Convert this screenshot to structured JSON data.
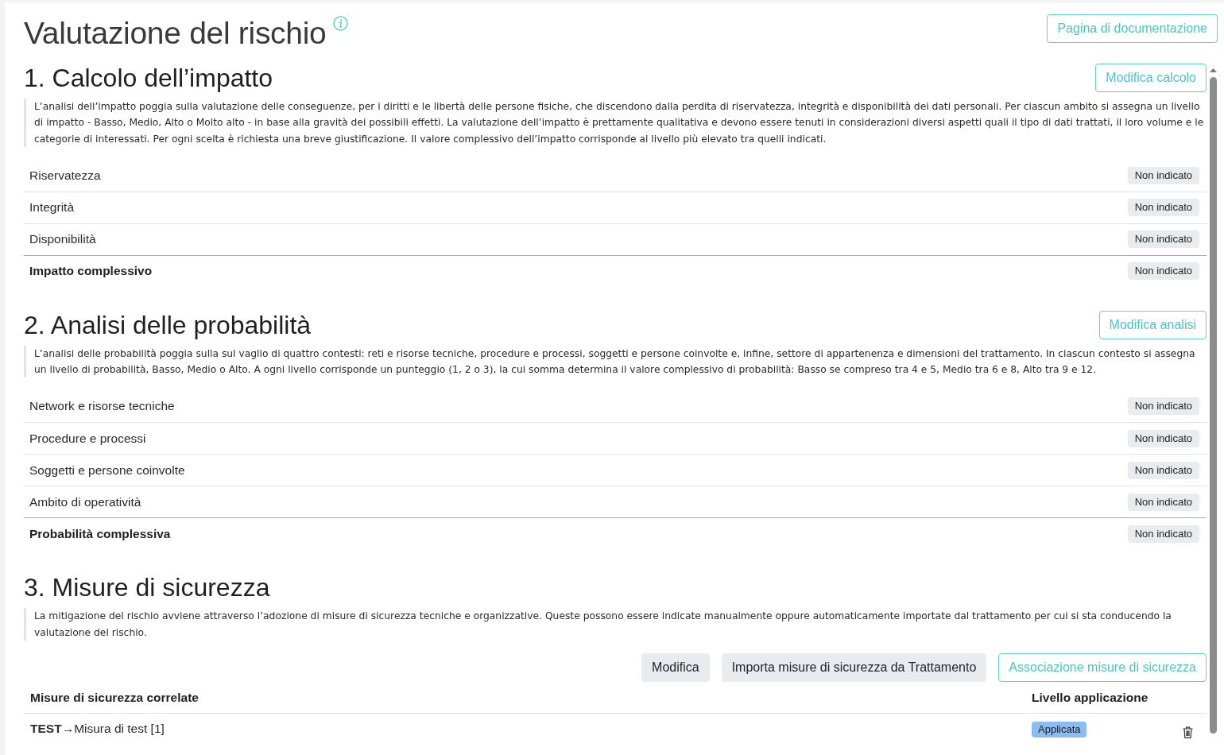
{
  "page": {
    "title": "Valutazione del rischio",
    "documentation_button": "Pagina di documentazione"
  },
  "sections": [
    {
      "kind": "rated",
      "heading": "1. Calcolo dell’impatto",
      "button": "Modifica calcolo",
      "description": "L’analisi dell’impatto poggia sulla valutazione delle conseguenze, per i diritti e le libertà delle persone fisiche, che discendono dalla perdita di riservatezza, integrità e disponibilità dei dati personali. Per ciascun ambito si assegna un livello di impatto - Basso, Medio, Alto o Molto alto - in base alla gravità dei possibili effetti. La valutazione dell’impatto è prettamente qualitativa e devono essere tenuti in considerazioni diversi aspetti quali il tipo di dati trattati, il loro volume e le categorie di interessati. Per ogni scelta è richiesta una breve giustificazione. Il valore complessivo dell’impatto corrisponde al livello più elevato tra quelli indicati.",
      "rows": [
        {
          "kind": "item",
          "label": "Riservatezza",
          "value": "Non indicato"
        },
        {
          "kind": "item",
          "label": "Integrità",
          "value": "Non indicato"
        },
        {
          "kind": "item",
          "label": "Disponibilità",
          "value": "Non indicato"
        },
        {
          "kind": "total",
          "label": "Impatto complessivo",
          "value": "Non indicato"
        }
      ]
    },
    {
      "kind": "rated",
      "heading": "2. Analisi delle probabilità",
      "button": "Modifica analisi",
      "description": "L’analisi delle probabilità poggia sulla sul vaglio di quattro contesti: reti e risorse tecniche, procedure e processi, soggetti e persone coinvolte e, infine, settore di appartenenza e dimensioni del trattamento. In ciascun contesto si assegna un livello di probabilità, Basso, Medio o Alto. A ogni livello corrisponde un punteggio (1, 2 o 3), la cui somma determina il valore complessivo di probabilità: Basso se compreso tra 4 e 5, Medio tra 6 e 8, Alto tra 9 e 12.",
      "rows": [
        {
          "kind": "item",
          "label": "Network e risorse tecniche",
          "value": "Non indicato"
        },
        {
          "kind": "item",
          "label": "Procedure e processi",
          "value": "Non indicato"
        },
        {
          "kind": "item",
          "label": "Soggetti e persone coinvolte",
          "value": "Non indicato"
        },
        {
          "kind": "item",
          "label": "Ambito di operatività",
          "value": "Non indicato"
        },
        {
          "kind": "total",
          "label": "Probabilità complessiva",
          "value": "Non indicato"
        }
      ]
    },
    {
      "kind": "measures",
      "heading": "3. Misure di sicurezza",
      "description": "La mitigazione del rischio avviene attraverso l’adozione di misure di sicurezza tecniche e organizzative. Queste possono essere indicate manualmente oppure automaticamente importate dal trattamento per cui si sta conducendo la valutazione del rischio.",
      "actions": [
        {
          "kind": "secondary",
          "label": "Modifica"
        },
        {
          "kind": "secondary",
          "label": "Importa misure di sicurezza da Trattamento"
        },
        {
          "kind": "outline",
          "label": "Associazione misure di sicurezza"
        }
      ],
      "table": {
        "columns": [
          "Misure di sicurezza correlate",
          "Livello applicazione"
        ],
        "rows": [
          {
            "measure": "**TEST**→Misura di test [1]",
            "level": "Applicata",
            "color": "#8cbcf2"
          }
        ]
      }
    }
  ]
}
